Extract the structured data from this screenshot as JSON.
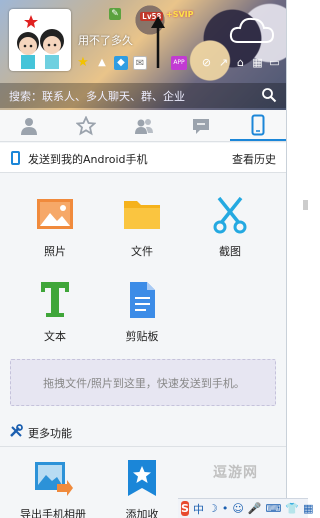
{
  "header": {
    "signature": "用不了多久",
    "level": "Lv58",
    "svip": "+SVIP",
    "search_placeholder": "搜索：联系人、多人聊天、群、企业"
  },
  "tabs": [
    {
      "icon": "contact-icon"
    },
    {
      "icon": "star-icon"
    },
    {
      "icon": "group-icon"
    },
    {
      "icon": "message-icon"
    },
    {
      "icon": "phone-icon",
      "active": true
    }
  ],
  "send": {
    "title": "发送到我的Android手机",
    "history": "查看历史"
  },
  "grid": [
    {
      "label": "照片",
      "icon": "photo-icon"
    },
    {
      "label": "文件",
      "icon": "folder-icon"
    },
    {
      "label": "截图",
      "icon": "scissors-icon"
    },
    {
      "label": "文本",
      "icon": "text-icon"
    },
    {
      "label": "剪贴板",
      "icon": "clipboard-icon"
    }
  ],
  "drop_zone": "拖拽文件/照片到这里，快速发送到手机。",
  "more": {
    "title": "更多功能",
    "items": [
      {
        "label": "导出手机相册",
        "icon": "export-album-icon"
      },
      {
        "label": "添加收",
        "icon": "add-favorite-icon"
      }
    ]
  },
  "watermark": "逗游网",
  "ime": {
    "logo": "S",
    "mode": "中"
  },
  "colors": {
    "accent": "#1b86d8",
    "photo": "#f08a3c",
    "folder": "#f5b21c",
    "scissors": "#24a9e1",
    "text": "#3fa63a"
  }
}
